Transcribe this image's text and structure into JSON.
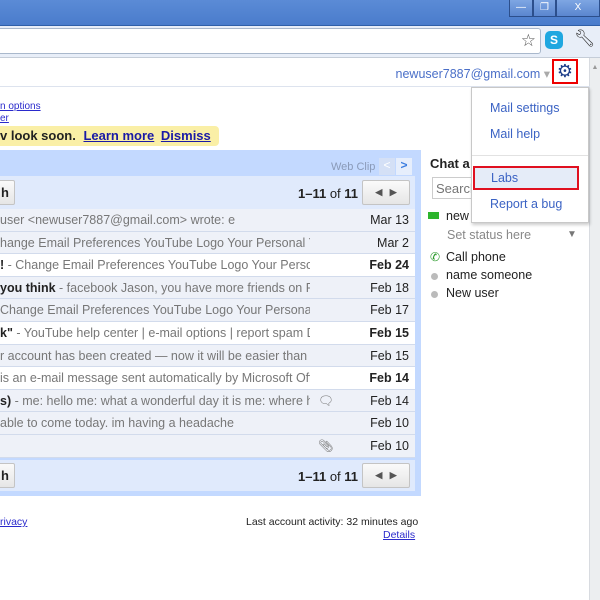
{
  "window": {
    "minimize": "—",
    "restore": "❐",
    "close": "X"
  },
  "toolbar": {
    "star_icon": "star-icon",
    "skype_icon": "skype-icon",
    "wrench_icon": "wrench-icon"
  },
  "header": {
    "email": "newuser7887@gmail.com",
    "dropdown": "▾",
    "gear": "⚙"
  },
  "links": {
    "options": "n options",
    "other": "er"
  },
  "notice": {
    "text": "v look soon.",
    "learn_more": "Learn more",
    "dismiss": "Dismiss"
  },
  "webclip": {
    "label": "Web Clip",
    "prev": "<",
    "next": ">"
  },
  "toolbar_button": "h",
  "pager": {
    "range": "1–11",
    "of": "of",
    "total": "11",
    "prev": "◀",
    "next": "▶"
  },
  "rows": [
    {
      "sender": "",
      "snippet": "user <newuser7887@gmail.com> wrote: e",
      "date": "Mar 13",
      "unread": false
    },
    {
      "sender": "",
      "snippet": "hange Email Preferences YouTube Logo Your Personal Y",
      "date": "Mar 2",
      "unread": false
    },
    {
      "sender": "!",
      "snippet": " - Change Email Preferences YouTube Logo Your Person",
      "date": "Feb 24",
      "unread": true
    },
    {
      "sender": "you think",
      "snippet": " - facebook Jason, you have more friends on Fac",
      "date": "Feb 18",
      "unread": false
    },
    {
      "sender": "",
      "snippet": "Change Email Preferences YouTube Logo Your Personal '",
      "date": "Feb 17",
      "unread": false
    },
    {
      "sender": "k\"",
      "snippet": " - YouTube help center | e-mail options | report spam De",
      "date": "Feb 15",
      "unread": true
    },
    {
      "sender": "",
      "snippet": "r account has been created — now it will be easier than e",
      "date": "Feb 15",
      "unread": false
    },
    {
      "sender": "",
      "snippet": "is an e-mail message sent automatically by Microsoft Offi",
      "date": "Feb 14",
      "unread": true
    },
    {
      "sender": "s)",
      "snippet": " - me: hello me: what a wonderful day it is me: where ha",
      "date": "Feb 14",
      "unread": false,
      "icon": "chat-bubble-icon"
    },
    {
      "sender": "",
      "snippet": "able to come today. im having a headache",
      "date": "Feb 10",
      "unread": false
    },
    {
      "sender": "",
      "snippet": "",
      "date": "Feb 10",
      "unread": false,
      "icon": "paperclip-icon"
    }
  ],
  "footer": {
    "privacy": "rivacy",
    "activity": "Last account activity: 32 minutes ago",
    "details": "Details"
  },
  "menu": {
    "items": [
      "Mail settings",
      "Mail help",
      "Labs",
      "Report a bug"
    ],
    "highlighted": "Labs"
  },
  "chat": {
    "title": "Chat a",
    "search_placeholder": "Search",
    "me": "new",
    "status": "Set status here",
    "call": "Call phone",
    "contacts": [
      "name someone",
      "New user"
    ]
  }
}
